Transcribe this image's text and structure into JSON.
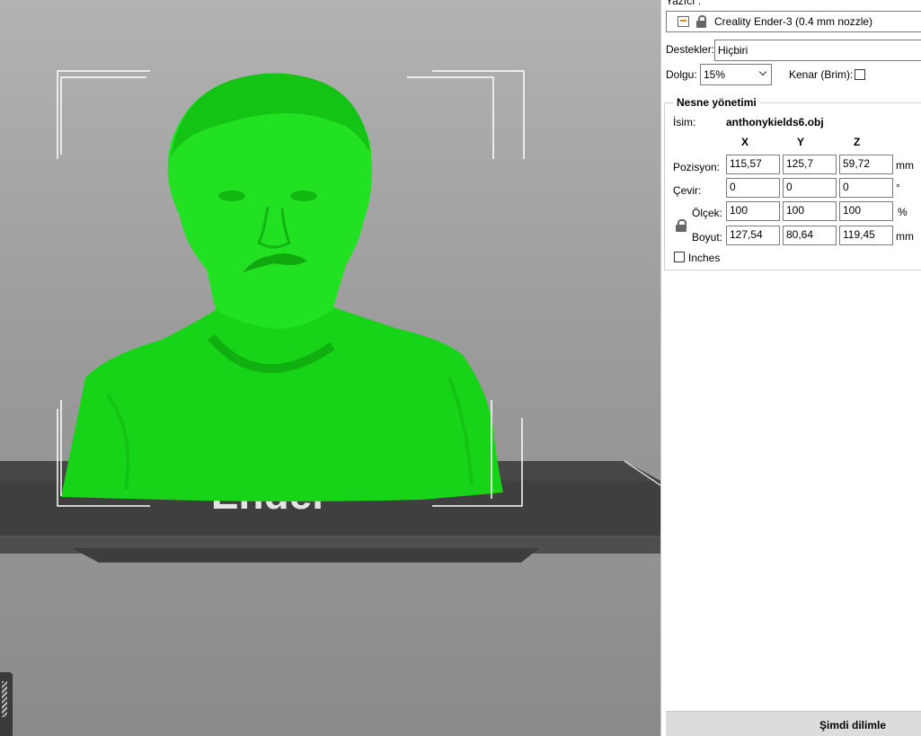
{
  "printer": {
    "section_label": "Yazıcı :",
    "name": "Creality Ender-3 (0.4 mm nozzle)"
  },
  "supports": {
    "label": "Destekler:",
    "value": "Hiçbiri"
  },
  "infill": {
    "label": "Dolgu:",
    "value": "15%"
  },
  "brim": {
    "label": "Kenar (Brim):",
    "checked": false
  },
  "object": {
    "group_title": "Nesne yönetimi",
    "name_label": "İsim:",
    "name": "anthonykields6.obj",
    "col_x": "X",
    "col_y": "Y",
    "col_z": "Z",
    "position": {
      "label": "Pozisyon:",
      "x": "115,57",
      "y": "125,7",
      "z": "59,72",
      "unit": "mm"
    },
    "rotate": {
      "label": "Çevir:",
      "x": "0",
      "y": "0",
      "z": "0",
      "unit": "°"
    },
    "scale": {
      "label": "Ölçek:",
      "x": "100",
      "y": "100",
      "z": "100",
      "unit": "%"
    },
    "size": {
      "label": "Boyut:",
      "x": "127,54",
      "y": "80,64",
      "z": "119,45",
      "unit": "mm"
    },
    "inches_label": "Inches"
  },
  "slice_button_label": "Şimdi dilimle",
  "viewport": {
    "bed_text": "Ender",
    "model_color": "#1fe01f"
  }
}
